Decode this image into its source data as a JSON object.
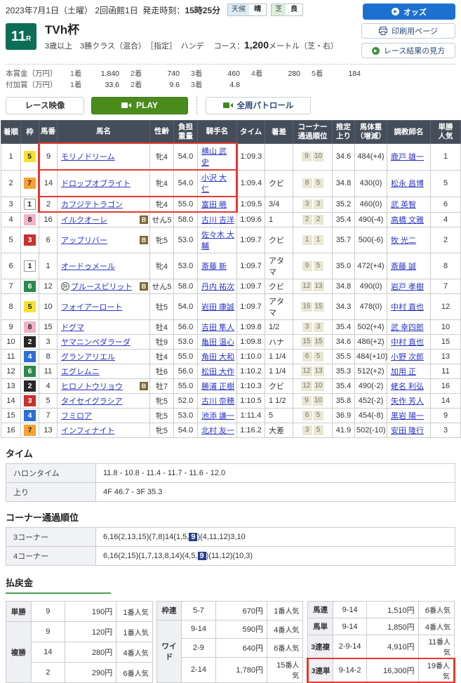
{
  "colors": {
    "accent_blue": "#1d6fd0",
    "race_no_green": "#0c6e57",
    "play_green": "#4a8c1c",
    "table_header": "#454d59",
    "link_blue": "#2b35c7",
    "highlight_red": "#e8382f",
    "corner_mark_navy": "#27408f",
    "pay_underline_green": "#4aa054"
  },
  "labels": {
    "yen": "円",
    "pop_suffix": "番人気"
  },
  "header": {
    "date": "2023年7月1日（土曜）",
    "meeting": "2回函館1日",
    "start_label": "発走時刻：",
    "start_time": "15時25分",
    "weather_label": "天候",
    "weather_value": "晴",
    "turf_label": "芝",
    "turf_value": "良",
    "odds_button": "オッズ",
    "print_button": "印刷用ページ",
    "guide_button": "レース結果の見方",
    "race_number": "11",
    "race_number_suffix": "R",
    "race_title": "TVh杯",
    "race_conditions": "3歳以上　3勝クラス（混合）　［指定］　ハンデ",
    "course_label": "コース：",
    "course_distance": "1,200",
    "course_unit": "メートル（芝・右）"
  },
  "prizes": {
    "main": {
      "label": "本賞金（万円）",
      "items": [
        {
          "place": "1着",
          "amount": "1,840"
        },
        {
          "place": "2着",
          "amount": "740"
        },
        {
          "place": "3着",
          "amount": "460"
        },
        {
          "place": "4着",
          "amount": "280"
        },
        {
          "place": "5着",
          "amount": "184"
        }
      ]
    },
    "additional": {
      "label": "付加賞（万円）",
      "items": [
        {
          "place": "1着",
          "amount": "33.6"
        },
        {
          "place": "2着",
          "amount": "9.6"
        },
        {
          "place": "3着",
          "amount": "4.8"
        }
      ]
    }
  },
  "video": {
    "race_video": "レース映像",
    "play": "PLAY",
    "patrol": "全周パトロール"
  },
  "results": {
    "headers": [
      "着順",
      "枠",
      "馬番",
      "馬名",
      "性齢",
      "負担\n重量",
      "騎手名",
      "タイム",
      "着差",
      "コーナー\n通過順位",
      "推定\n上り",
      "馬体重\n（増減）",
      "調教師名",
      "単勝\n人気"
    ],
    "rows": [
      {
        "place": "1",
        "frame": "5",
        "no": "9",
        "mark": "",
        "name": "モリノドリーム",
        "b": false,
        "sex_age": "牝4",
        "weight": "54.0",
        "jockey": "横山 武史",
        "time": "1:09.3",
        "margin": "",
        "c3": "9",
        "c4": "10",
        "up": "34.6",
        "hweight": "484(+4)",
        "trainer": "鹿戸 雄一",
        "pop": "1",
        "hl": true
      },
      {
        "place": "2",
        "frame": "7",
        "no": "14",
        "mark": "",
        "name": "ドロップオブライト",
        "b": false,
        "sex_age": "牝4",
        "weight": "54.0",
        "jockey": "小沢 大仁",
        "time": "1:09.4",
        "margin": "クビ",
        "c3": "8",
        "c4": "5",
        "up": "34.8",
        "hweight": "430(0)",
        "trainer": "松永 昌博",
        "pop": "5",
        "hl": true
      },
      {
        "place": "3",
        "frame": "1",
        "no": "2",
        "mark": "",
        "name": "カフジテトラゴン",
        "b": false,
        "sex_age": "牝4",
        "weight": "55.0",
        "jockey": "富田 暁",
        "time": "1:09.5",
        "margin": "3/4",
        "c3": "3",
        "c4": "3",
        "up": "35.2",
        "hweight": "460(0)",
        "trainer": "武 英智",
        "pop": "6",
        "hl": true
      },
      {
        "place": "4",
        "frame": "8",
        "no": "16",
        "mark": "",
        "name": "イルクオーレ",
        "b": true,
        "sex_age": "せん5",
        "weight": "58.0",
        "jockey": "古川 吉洋",
        "time": "1:09.6",
        "margin": "1",
        "c3": "2",
        "c4": "2",
        "up": "35.4",
        "hweight": "490(-4)",
        "trainer": "高橋 文雅",
        "pop": "4",
        "hl": false
      },
      {
        "place": "5",
        "frame": "3",
        "no": "6",
        "mark": "",
        "name": "アップリバー",
        "b": true,
        "sex_age": "牝5",
        "weight": "53.0",
        "jockey": "佐々木 大輔",
        "time": "1:09.7",
        "margin": "クビ",
        "c3": "1",
        "c4": "1",
        "up": "35.7",
        "hweight": "500(-6)",
        "trainer": "牧 光二",
        "pop": "2",
        "hl": false
      },
      {
        "place": "6",
        "frame": "1",
        "no": "1",
        "mark": "",
        "name": "オードゥメール",
        "b": false,
        "sex_age": "牝4",
        "weight": "53.0",
        "jockey": "斎藤 新",
        "time": "1:09.7",
        "margin": "アタマ",
        "c3": "9",
        "c4": "5",
        "up": "35.0",
        "hweight": "472(+4)",
        "trainer": "斎藤 誠",
        "pop": "8",
        "hl": false
      },
      {
        "place": "7",
        "frame": "6",
        "no": "12",
        "mark": "外",
        "name": "ブルースピリット",
        "b": true,
        "sex_age": "せん5",
        "weight": "58.0",
        "jockey": "丹内 祐次",
        "time": "1:09.7",
        "margin": "クビ",
        "c3": "12",
        "c4": "13",
        "up": "34.8",
        "hweight": "490(0)",
        "trainer": "岩戸 孝樹",
        "pop": "7",
        "hl": false
      },
      {
        "place": "8",
        "frame": "5",
        "no": "10",
        "mark": "",
        "name": "フォイアーロート",
        "b": false,
        "sex_age": "牡5",
        "weight": "54.0",
        "jockey": "岩田 康誠",
        "time": "1:09.7",
        "margin": "アタマ",
        "c3": "16",
        "c4": "15",
        "up": "34.3",
        "hweight": "478(0)",
        "trainer": "中村 直也",
        "pop": "12",
        "hl": false
      },
      {
        "place": "9",
        "frame": "8",
        "no": "15",
        "mark": "",
        "name": "ドグマ",
        "b": false,
        "sex_age": "牡4",
        "weight": "56.0",
        "jockey": "吉田 隼人",
        "time": "1:09.8",
        "margin": "1/2",
        "c3": "3",
        "c4": "3",
        "up": "35.4",
        "hweight": "502(+4)",
        "trainer": "武 幸四郎",
        "pop": "10",
        "hl": false
      },
      {
        "place": "10",
        "frame": "2",
        "no": "3",
        "mark": "",
        "name": "ヤマニンペダラーダ",
        "b": false,
        "sex_age": "牡9",
        "weight": "53.0",
        "jockey": "亀田 温心",
        "time": "1:09.8",
        "margin": "ハナ",
        "c3": "15",
        "c4": "15",
        "up": "34.6",
        "hweight": "486(+2)",
        "trainer": "中村 直也",
        "pop": "15",
        "hl": false
      },
      {
        "place": "11",
        "frame": "4",
        "no": "8",
        "mark": "",
        "name": "グランアリエル",
        "b": false,
        "sex_age": "牡4",
        "weight": "55.0",
        "jockey": "角田 大和",
        "time": "1:10.0",
        "margin": "1 1/4",
        "c3": "6",
        "c4": "5",
        "up": "35.5",
        "hweight": "484(+10)",
        "trainer": "小野 次郎",
        "pop": "13",
        "hl": false
      },
      {
        "place": "12",
        "frame": "6",
        "no": "11",
        "mark": "",
        "name": "エグレムニ",
        "b": false,
        "sex_age": "牡6",
        "weight": "56.0",
        "jockey": "松田 大作",
        "time": "1:10.2",
        "margin": "1 1/4",
        "c3": "12",
        "c4": "13",
        "up": "35.3",
        "hweight": "512(+2)",
        "trainer": "加用 正",
        "pop": "11",
        "hl": false
      },
      {
        "place": "13",
        "frame": "2",
        "no": "4",
        "mark": "",
        "name": "ヒロノトウリョウ",
        "b": true,
        "sex_age": "牡7",
        "weight": "55.0",
        "jockey": "勝浦 正樹",
        "time": "1:10.3",
        "margin": "クビ",
        "c3": "12",
        "c4": "10",
        "up": "35.4",
        "hweight": "490(-2)",
        "trainer": "蛯名 利弘",
        "pop": "16",
        "hl": false
      },
      {
        "place": "14",
        "frame": "3",
        "no": "5",
        "mark": "",
        "name": "タイセイグラシア",
        "b": false,
        "sex_age": "牝5",
        "weight": "52.0",
        "jockey": "古川 奈穂",
        "time": "1:10.5",
        "margin": "1 1/2",
        "c3": "9",
        "c4": "10",
        "up": "35.8",
        "hweight": "452(-2)",
        "trainer": "矢作 芳人",
        "pop": "14",
        "hl": false
      },
      {
        "place": "15",
        "frame": "4",
        "no": "7",
        "mark": "",
        "name": "フミロア",
        "b": false,
        "sex_age": "牝5",
        "weight": "53.0",
        "jockey": "池添 謙一",
        "time": "1:11.4",
        "margin": "5",
        "c3": "6",
        "c4": "5",
        "up": "36.9",
        "hweight": "454(-8)",
        "trainer": "黒岩 陽一",
        "pop": "9",
        "hl": false
      },
      {
        "place": "16",
        "frame": "7",
        "no": "13",
        "mark": "",
        "name": "インフィナイト",
        "b": false,
        "sex_age": "牝5",
        "weight": "54.0",
        "jockey": "北村 友一",
        "time": "1:16.2",
        "margin": "大差",
        "c3": "3",
        "c4": "5",
        "up": "41.9",
        "hweight": "502(-10)",
        "trainer": "安田 隆行",
        "pop": "3",
        "hl": false
      }
    ]
  },
  "time_section": {
    "title": "タイム",
    "furlong_label": "ハロンタイム",
    "furlong_value": "11.8 - 10.8 - 11.4 - 11.7 - 11.6 - 12.0",
    "up_label": "上り",
    "up_value": "4F 46.7 - 3F 35.3"
  },
  "corner_section": {
    "title": "コーナー通過順位",
    "c3_label": "3コーナー",
    "c3_before": "6,16(2,13,15)(7,8)14(1,5,",
    "c3_mark": "9",
    "c3_after": ")(4,11,12)3,10",
    "c4_label": "4コーナー",
    "c4_before": "6,16(2,15)(1,7,13,8,14)(4,5,",
    "c4_mark": "9",
    "c4_after": ")(11,12)(10,3)"
  },
  "payouts": {
    "title": "払戻金",
    "win": {
      "type": "単勝",
      "no": "9",
      "amount": "190",
      "pop": "1"
    },
    "place_label": "複勝",
    "place": [
      {
        "no": "9",
        "amount": "120",
        "pop": "1"
      },
      {
        "no": "14",
        "amount": "280",
        "pop": "4"
      },
      {
        "no": "2",
        "amount": "290",
        "pop": "6"
      }
    ],
    "wakuren": {
      "type": "枠連",
      "no": "5-7",
      "amount": "670",
      "pop": "1"
    },
    "wide_label": "ワイド",
    "wide": [
      {
        "no": "9-14",
        "amount": "590",
        "pop": "4"
      },
      {
        "no": "2-9",
        "amount": "640",
        "pop": "6"
      },
      {
        "no": "2-14",
        "amount": "1,780",
        "pop": "15"
      }
    ],
    "umaren": {
      "type": "馬連",
      "no": "9-14",
      "amount": "1,510",
      "pop": "6"
    },
    "umatan": {
      "type": "馬単",
      "no": "9-14",
      "amount": "1,850",
      "pop": "4"
    },
    "sanrenpuku": {
      "type": "3連複",
      "no": "2-9-14",
      "amount": "4,910",
      "pop": "11"
    },
    "sanrentan": {
      "type": "3連単",
      "no": "9-14-2",
      "amount": "16,300",
      "pop": "19"
    }
  }
}
